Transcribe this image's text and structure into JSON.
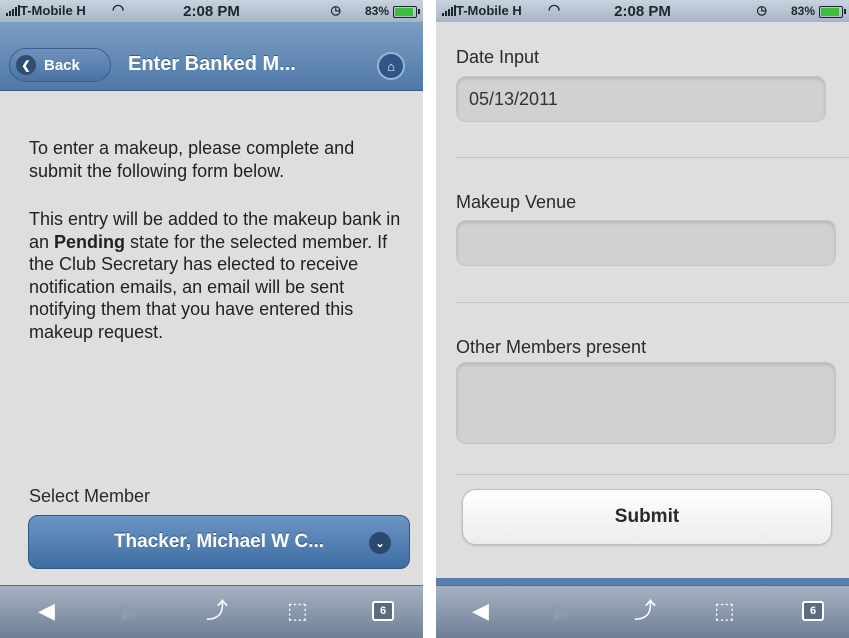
{
  "status_bar": {
    "carrier": "T-Mobile H",
    "time": "2:08 PM",
    "battery_pct": "83%",
    "wifi_icon": "◠",
    "alarm_icon": "◷"
  },
  "left": {
    "header": {
      "back_label": "Back",
      "back_icon": "❮",
      "title": "Enter Banked M...",
      "home_icon": "⌂"
    },
    "intro": "To enter a makeup, please complete and submit the following form below.",
    "detail": {
      "part1": "This entry will be added to the makeup bank in an ",
      "bold": "Pending",
      "part2": " state for the selected member.   If the Club Secretary has elected to receive notification emails, an email will be sent notifying them that you have entered this makeup request."
    },
    "select_label": "Select Member",
    "select_value": "Thacker, Michael W C...",
    "select_icon": "⌄"
  },
  "right": {
    "date_label": "Date Input",
    "date_value": "05/13/2011",
    "venue_label": "Makeup Venue",
    "venue_value": "",
    "others_label": "Other Members present",
    "others_value": "",
    "submit_label": "Submit"
  },
  "toolbar": {
    "back_icon": "◀",
    "forward_icon": "▶",
    "share_icon": "⤴",
    "bookmarks_icon": "⬚",
    "pages_count": "6"
  }
}
